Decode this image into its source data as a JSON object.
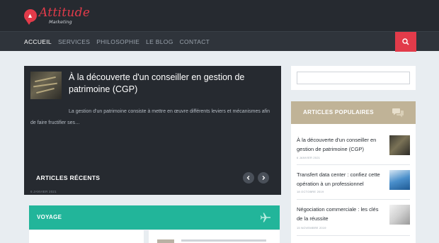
{
  "brand": {
    "name": "Attitude",
    "tagline": "Marketing",
    "accent": "#e23b4a"
  },
  "nav": {
    "items": [
      {
        "label": "ACCUEIL",
        "active": true
      },
      {
        "label": "SERVICES",
        "active": false
      },
      {
        "label": "PHILOSOPHIE",
        "active": false
      },
      {
        "label": "LE BLOG",
        "active": false
      },
      {
        "label": "CONTACT",
        "active": false
      }
    ],
    "search_icon": "search-icon"
  },
  "featured": {
    "title": "À la découverte d'un conseiller en gestion de patrimoine (CGP)",
    "excerpt": "La gestion d'un patrimoine consiste à mettre en œuvre différents leviers et mécanismes afin de faire fructifier ses…",
    "date": "6 JANVIER 2021",
    "section_label": "ARTICLES RÉCENTS",
    "prev_icon": "chevron-left-icon",
    "next_icon": "chevron-right-icon"
  },
  "voyage": {
    "label": "VOYAGE",
    "icon": "airplane-icon",
    "color": "#22b59a"
  },
  "sidebar": {
    "popular_label": "ARTICLES POPULAIRES",
    "popular_icon": "chat-bubbles-icon",
    "popular_color": "#c0b397",
    "items": [
      {
        "title": "À la découverte d'un conseiller en gestion de patrimoine (CGP)",
        "date": "6 JANVIER 2021"
      },
      {
        "title": "Transfert data center : confiez cette opération à un professionnel",
        "date": "18 OCTOBRE 2019"
      },
      {
        "title": "Négociation commerciale : les clés de la réussite",
        "date": "15 NOVEMBRE 2019"
      }
    ]
  }
}
